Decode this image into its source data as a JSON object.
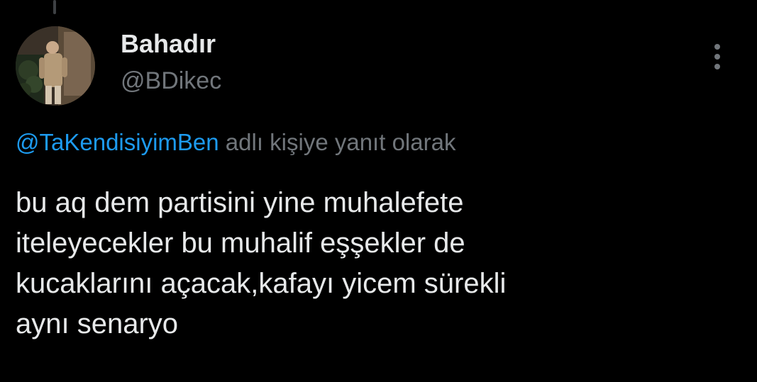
{
  "tweet": {
    "author": {
      "display_name": "Bahadır",
      "handle": "@BDikec",
      "avatar_icon": "profile-photo-avatar"
    },
    "more_icon": "more-vertical-icon",
    "reply_context": {
      "mention": "@TaKendisiyimBen",
      "suffix": "adlı kişiye yanıt olarak"
    },
    "text": "bu aq dem partisini yine muhalefete\niteleyecekler bu muhalif eşşekler de\nkucaklarını açacak,kafayı yicem sürekli\naynı senaryo"
  },
  "colors": {
    "background": "#000000",
    "primary_text": "#e7e9ea",
    "secondary_text": "#71767b",
    "link": "#1d9bf0",
    "thread_line": "#3e4144"
  }
}
